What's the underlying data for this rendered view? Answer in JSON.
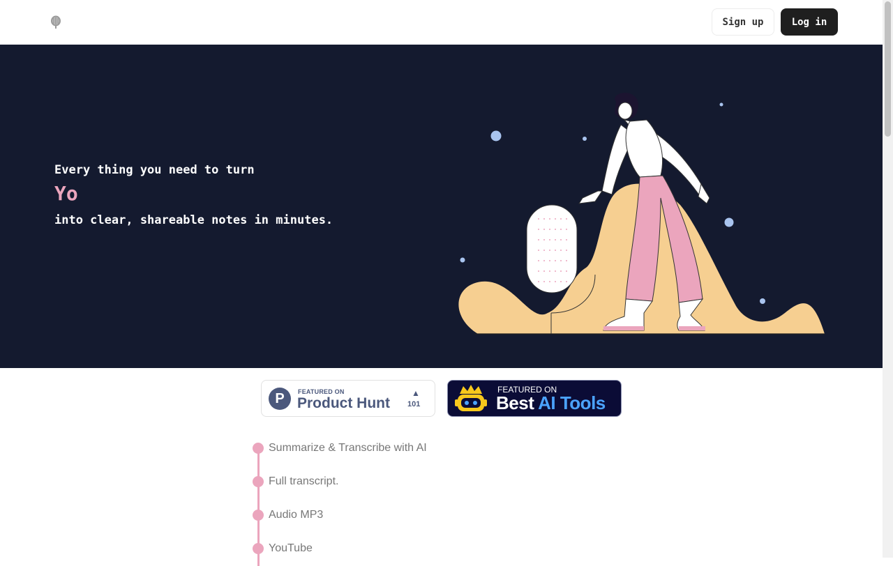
{
  "header": {
    "logo_icon": "microphone-logo-icon",
    "signup_label": "Sign up",
    "login_label": "Log in"
  },
  "hero": {
    "line1": "Every thing you need to turn",
    "typed_word": "Yo",
    "line3": "into clear, shareable notes in minutes.",
    "accent_color": "#eba5bd",
    "background_color": "#141a2f",
    "illustration": "woman-with-microphone-illustration"
  },
  "badges": {
    "product_hunt": {
      "icon": "product-hunt-icon",
      "logo_letter": "P",
      "small_label": "FEATURED ON",
      "name": "Product Hunt",
      "upvote_icon": "triangle-up-icon",
      "upvote_symbol": "▲",
      "count": "101"
    },
    "best_ai_tools": {
      "icon": "robot-crown-icon",
      "small_label": "FEATURED ON",
      "name_part1": "Best ",
      "name_part2": "AI Tools"
    }
  },
  "features": [
    {
      "label": "Summarize & Transcribe with AI"
    },
    {
      "label": "Full transcript."
    },
    {
      "label": "Audio MP3"
    },
    {
      "label": "YouTube"
    }
  ]
}
